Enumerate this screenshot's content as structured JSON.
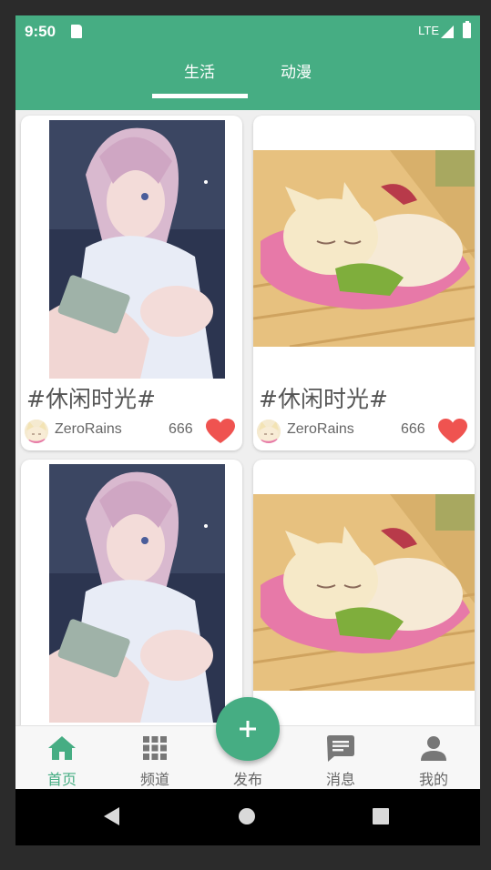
{
  "status_bar": {
    "time": "9:50",
    "network": "LTE",
    "icons": [
      "sd-card-icon",
      "signal-icon",
      "battery-icon"
    ]
  },
  "tabs": [
    {
      "label": "生活",
      "selected": true
    },
    {
      "label": "动漫",
      "selected": false
    }
  ],
  "cards": [
    {
      "image": "anime-girl-reading",
      "title": "#休闲时光#",
      "author": "ZeroRains",
      "likes": "666"
    },
    {
      "image": "fox-girl-sleeping",
      "title": "#休闲时光#",
      "author": "ZeroRains",
      "likes": "666"
    },
    {
      "image": "anime-girl-reading"
    },
    {
      "image": "fox-girl-sleeping"
    }
  ],
  "bottom_nav": [
    {
      "label": "首页",
      "icon": "home-icon",
      "active": true
    },
    {
      "label": "频道",
      "icon": "grid-icon",
      "active": false
    },
    {
      "label": "发布",
      "icon": "add-icon",
      "active": false
    },
    {
      "label": "消息",
      "icon": "message-icon",
      "active": false
    },
    {
      "label": "我的",
      "icon": "person-icon",
      "active": false
    }
  ],
  "fab": {
    "symbol": "+"
  },
  "colors": {
    "primary": "#46ad83",
    "heart": "#ef5350",
    "text": "#555555"
  }
}
